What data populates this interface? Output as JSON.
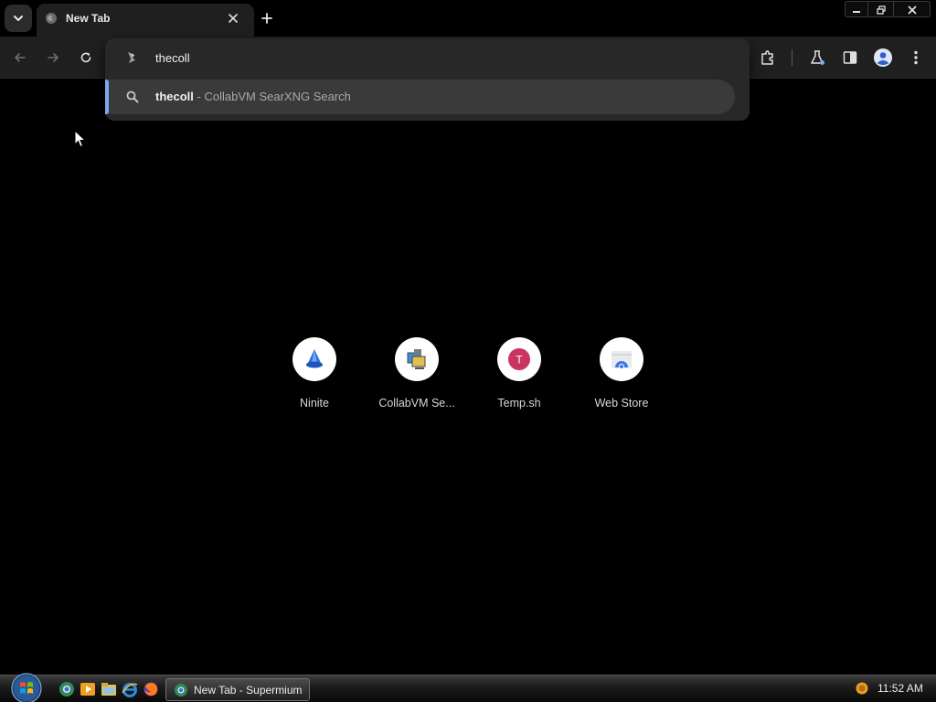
{
  "tab": {
    "title": "New Tab"
  },
  "omnibox": {
    "input_value": "thecoll",
    "suggestion": {
      "query": "thecoll",
      "separator": "-",
      "description": "CollabVM SearXNG Search"
    }
  },
  "shortcuts": [
    {
      "label": "Ninite",
      "icon": "ninite-icon"
    },
    {
      "label": "CollabVM Se...",
      "icon": "collabvm-icon"
    },
    {
      "label": "Temp.sh",
      "icon": "temp-sh-icon",
      "letter": "T"
    },
    {
      "label": "Web Store",
      "icon": "web-store-icon"
    }
  ],
  "taskbar": {
    "task_button_label": "New Tab - Supermium",
    "clock": "11:52 AM"
  },
  "colors": {
    "accent": "#7ca6f7",
    "toolbar_bg": "#1f1f1f",
    "page_bg": "#000000",
    "temp_sh": "#c8365f"
  }
}
